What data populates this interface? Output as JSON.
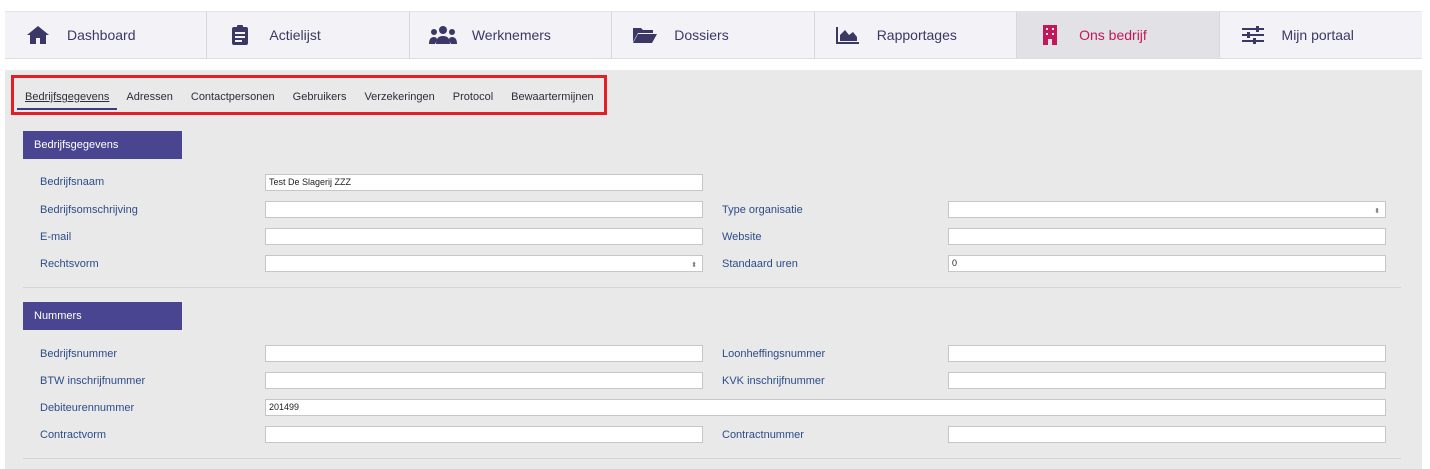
{
  "nav": [
    {
      "label": "Dashboard",
      "icon": "home-icon",
      "active": false
    },
    {
      "label": "Actielijst",
      "icon": "clipboard-icon",
      "active": false
    },
    {
      "label": "Werknemers",
      "icon": "users-icon",
      "active": false
    },
    {
      "label": "Dossiers",
      "icon": "folder-icon",
      "active": false
    },
    {
      "label": "Rapportages",
      "icon": "area-chart-icon",
      "active": false
    },
    {
      "label": "Ons bedrijf",
      "icon": "building-icon",
      "active": true
    },
    {
      "label": "Mijn portaal",
      "icon": "sliders-icon",
      "active": false
    }
  ],
  "tabs": [
    "Bedrijfsgegevens",
    "Adressen",
    "Contactpersonen",
    "Gebruikers",
    "Verzekeringen",
    "Protocol",
    "Bewaartermijnen"
  ],
  "colors": {
    "accent": "#4a4590",
    "active_nav": "#c2185b",
    "highlight_border": "#e41e26",
    "label": "#2b4d8a"
  },
  "section1": {
    "title": "Bedrijfsgegevens",
    "bedrijfsnaam": {
      "label": "Bedrijfsnaam",
      "value": "Test De Slagerij ZZZ"
    },
    "omschrijving": {
      "label": "Bedrijfsomschrijving",
      "value": ""
    },
    "email": {
      "label": "E-mail",
      "value": ""
    },
    "rechtsvorm": {
      "label": "Rechtsvorm",
      "value": ""
    },
    "type_org": {
      "label": "Type organisatie",
      "value": ""
    },
    "website": {
      "label": "Website",
      "value": ""
    },
    "standaard_uren": {
      "label": "Standaard uren",
      "value": "0"
    }
  },
  "section2": {
    "title": "Nummers",
    "bedrijfsnummer": {
      "label": "Bedrijfsnummer",
      "value": ""
    },
    "btw": {
      "label": "BTW inschrijfnummer",
      "value": ""
    },
    "debiteuren": {
      "label": "Debiteurennummer",
      "value": "201499"
    },
    "contractvorm": {
      "label": "Contractvorm",
      "value": ""
    },
    "loonheffing": {
      "label": "Loonheffingsnummer",
      "value": ""
    },
    "kvk": {
      "label": "KVK inschrijfnummer",
      "value": ""
    },
    "contractnummer": {
      "label": "Contractnummer",
      "value": ""
    }
  }
}
